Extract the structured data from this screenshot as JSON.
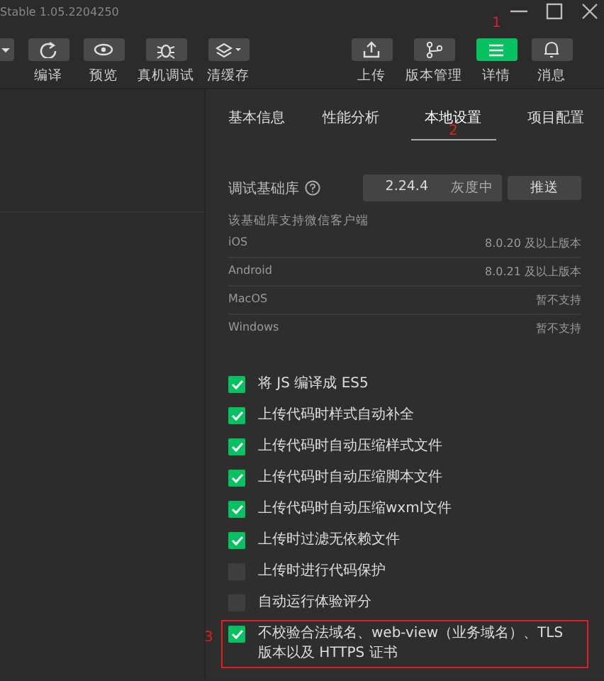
{
  "window": {
    "title": "Stable 1.05.2204250"
  },
  "toolbar": {
    "left": [
      {
        "kind": "caret"
      },
      {
        "kind": "refresh",
        "label": "编译"
      },
      {
        "kind": "eye",
        "label": "预览"
      },
      {
        "kind": "bug",
        "label": "真机调试"
      },
      {
        "kind": "layers",
        "label": "清缓存"
      }
    ],
    "right": [
      {
        "kind": "upload",
        "label": "上传",
        "selected": false
      },
      {
        "kind": "branch",
        "label": "版本管理",
        "selected": false
      },
      {
        "kind": "menu",
        "label": "详情",
        "selected": true,
        "annotation": "1"
      },
      {
        "kind": "bell",
        "label": "消息",
        "selected": false
      }
    ]
  },
  "tabs": [
    {
      "label": "基本信息",
      "selected": false
    },
    {
      "label": "性能分析",
      "selected": false
    },
    {
      "label": "本地设置",
      "selected": true,
      "annotation": "2"
    },
    {
      "label": "项目配置",
      "selected": false
    }
  ],
  "base_library": {
    "label": "调试基础库",
    "version": "2.24.4",
    "status": "灰度中",
    "button": "推送"
  },
  "support": {
    "title": "该基础库支持微信客户端",
    "rows": [
      {
        "platform": "iOS",
        "requirement": "8.0.20 及以上版本"
      },
      {
        "platform": "Android",
        "requirement": "8.0.21 及以上版本"
      },
      {
        "platform": "MacOS",
        "requirement": "暂不支持"
      },
      {
        "platform": "Windows",
        "requirement": "暂不支持"
      }
    ]
  },
  "options": [
    {
      "label": "将 JS 编译成 ES5",
      "checked": true
    },
    {
      "label": "上传代码时样式自动补全",
      "checked": true
    },
    {
      "label": "上传代码时自动压缩样式文件",
      "checked": true
    },
    {
      "label": "上传代码时自动压缩脚本文件",
      "checked": true
    },
    {
      "label": "上传代码时自动压缩wxml文件",
      "checked": true
    },
    {
      "label": "上传时过滤无依赖文件",
      "checked": true
    },
    {
      "label": "上传时进行代码保护",
      "checked": false
    },
    {
      "label": "自动运行体验评分",
      "checked": false
    },
    {
      "label": "不校验合法域名、web-view（业务域名）、TLS 版本以及 HTTPS 证书",
      "checked": true,
      "highlighted": true,
      "annotation": "3"
    }
  ]
}
